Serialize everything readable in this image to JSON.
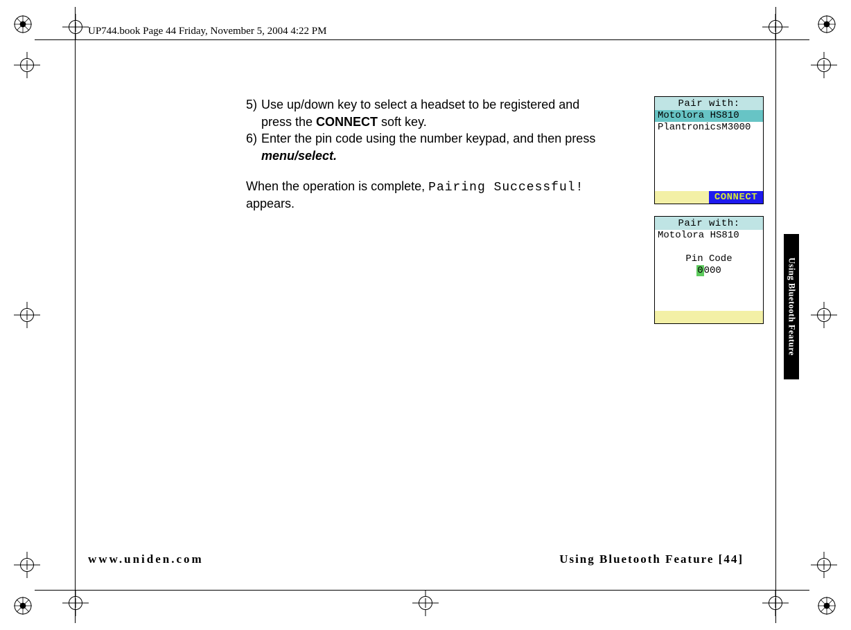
{
  "header": {
    "line": "UP744.book  Page 44  Friday, November 5, 2004  4:22 PM"
  },
  "steps": {
    "s5a": "5)",
    "s5b": "Use up/down key to select a headset to be registered and",
    "s5c": "press the ",
    "s5c_bold": "CONNECT",
    "s5d": " soft key.",
    "s6a": "6)",
    "s6b": "Enter the pin code using the number keypad, and then press",
    "s6c": "menu/select.",
    "para1": "When the operation is complete, ",
    "para_lcd": "Pairing Successful!",
    "para2": " appears."
  },
  "lcd1": {
    "title": "Pair with:",
    "item1": "Motolora HS810",
    "item2": "PlantronicsM3000",
    "softkey_right": "CONNECT"
  },
  "lcd2": {
    "title": "Pair with:",
    "item1": "Motolora HS810",
    "pinlabel": "Pin Code",
    "pin_first": "0",
    "pin_rest": "000"
  },
  "sidebar": {
    "label": "Using Bluetooth Feature"
  },
  "footer": {
    "left": "www.uniden.com",
    "right": "Using Bluetooth Feature [44]"
  }
}
